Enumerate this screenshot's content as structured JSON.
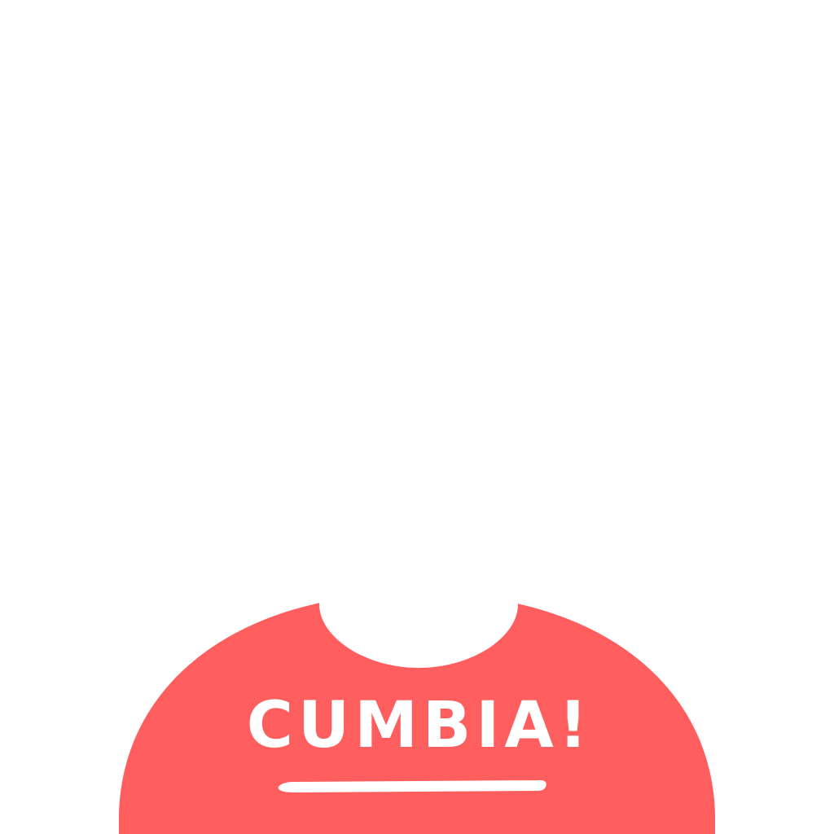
{
  "shirt": {
    "text": "CUMBIA!",
    "color": "#ff5e5e",
    "text_color": "#ffffff"
  },
  "background_color": "#ffffff"
}
